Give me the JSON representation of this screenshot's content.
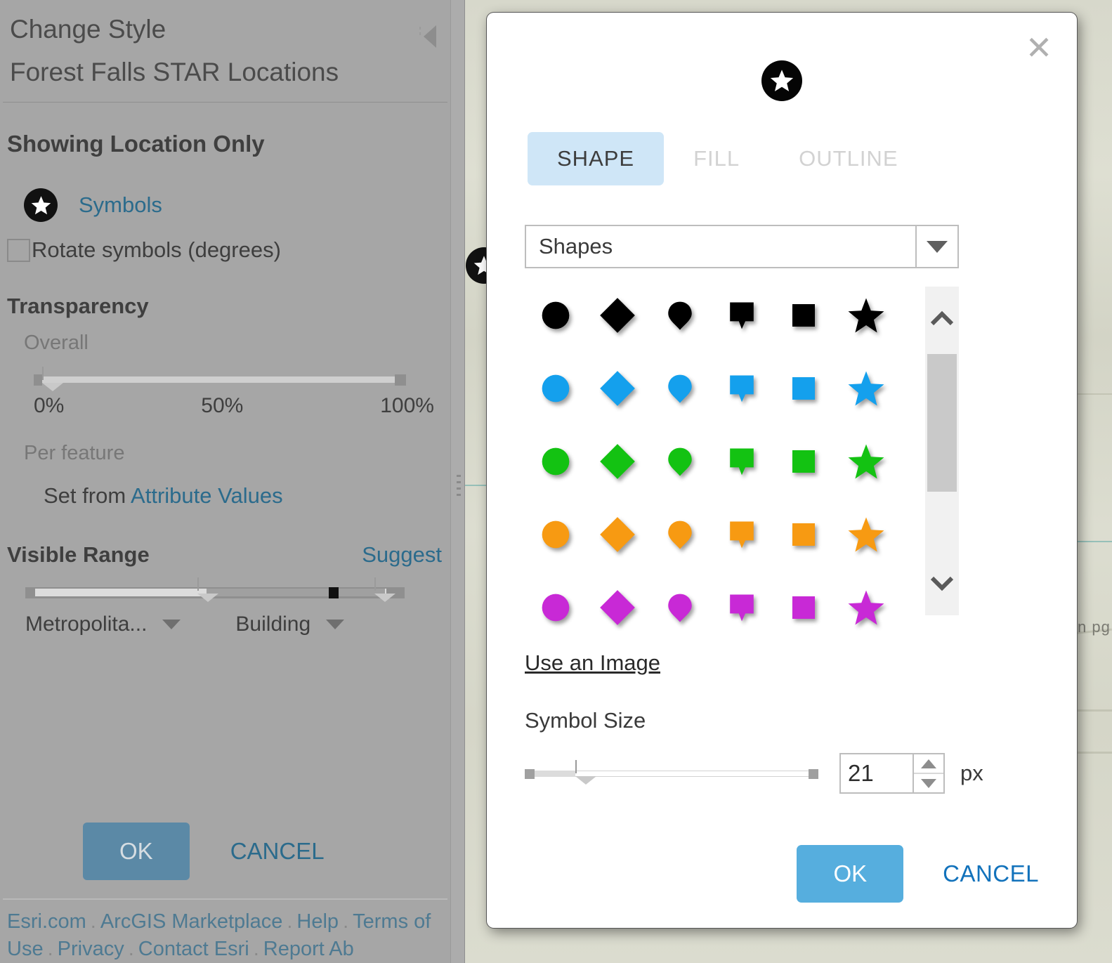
{
  "panel": {
    "title": "Change Style",
    "layer_name": "Forest Falls STAR Locations",
    "showing_heading": "Showing Location Only",
    "symbols_link": "Symbols",
    "rotate_label": "Rotate symbols (degrees)",
    "transparency": {
      "heading": "Transparency",
      "overall_label": "Overall",
      "ticks": [
        "0%",
        "50%",
        "100%"
      ],
      "overall_value": 0,
      "per_feature_label": "Per feature",
      "set_from_prefix": "Set from ",
      "set_from_link": "Attribute Values"
    },
    "visible_range": {
      "heading": "Visible Range",
      "suggest_link": "Suggest",
      "min_select": "Metropolita...",
      "max_select": "Building"
    },
    "ok_label": "OK",
    "cancel_label": "CANCEL",
    "footer_links": [
      "Esri.com",
      "ArcGIS Marketplace",
      "Help",
      "Terms",
      "of Use",
      "Privacy",
      "Contact Esri",
      "Report Ab"
    ],
    "footer_separator": "."
  },
  "dialog": {
    "close_icon": "close-icon",
    "tabs": [
      {
        "label": "SHAPE",
        "state": "active"
      },
      {
        "label": "FILL",
        "state": "disabled"
      },
      {
        "label": "OUTLINE",
        "state": "disabled"
      }
    ],
    "category_select": {
      "value": "Shapes"
    },
    "shape_grid": {
      "columns": [
        "circle",
        "diamond",
        "pin",
        "flag",
        "square",
        "star"
      ],
      "rows": [
        {
          "color": "#000000",
          "name": "black"
        },
        {
          "color": "#14a0ed",
          "name": "blue"
        },
        {
          "color": "#13c212",
          "name": "green"
        },
        {
          "color": "#f79a12",
          "name": "orange"
        },
        {
          "color": "#c829d6",
          "name": "magenta"
        }
      ]
    },
    "use_image_link": "Use an Image",
    "symbol_size": {
      "label": "Symbol Size",
      "value": "21",
      "unit": "px"
    },
    "ok_label": "OK",
    "cancel_label": "CANCEL"
  },
  "map": {
    "label_fragment": "n pg",
    "marker_icon": "star-marker-icon"
  },
  "colors": {
    "panel_bg": "#a6a6a6",
    "link_blue": "#2b6b8c",
    "dialog_ok": "#56aede",
    "panel_ok": "#5b89a6",
    "tab_active_bg": "#cfe6f7"
  }
}
